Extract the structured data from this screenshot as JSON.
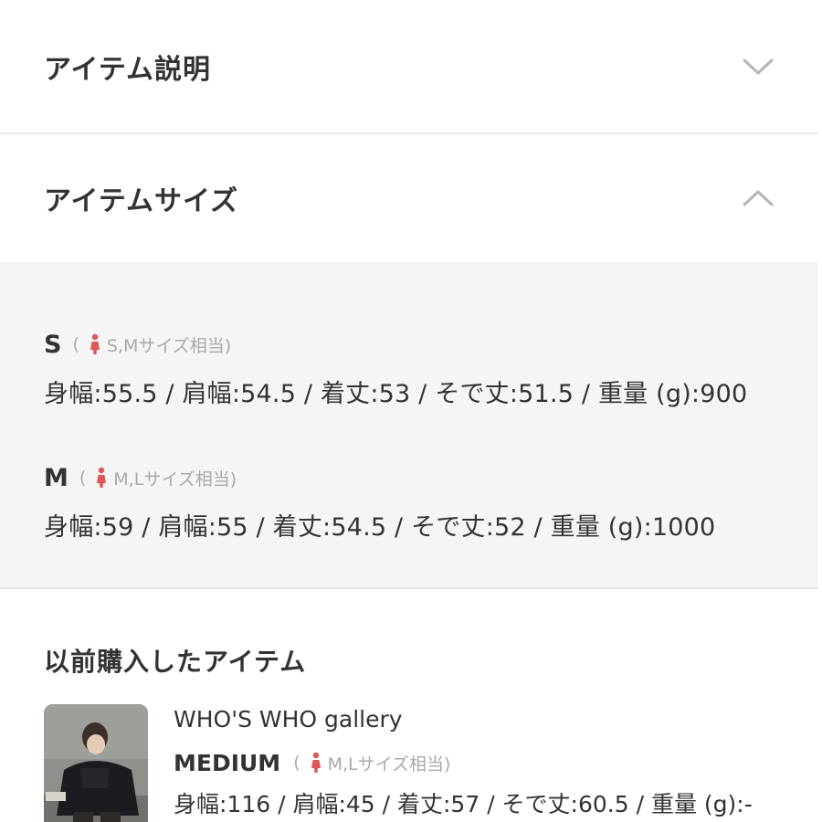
{
  "item_description": {
    "title": "アイテム説明",
    "chevron": "chevron-down-icon"
  },
  "item_size": {
    "title": "アイテムサイズ",
    "chevron": "chevron-up-icon",
    "sizes": [
      {
        "label": "S",
        "note_open": "(",
        "note_text": "S,Mサイズ相当)",
        "measurements": "身幅:55.5 / 肩幅:54.5 / 着丈:53 / そで丈:51.5 / 重量 (g):900"
      },
      {
        "label": "M",
        "note_open": "(",
        "note_text": "M,Lサイズ相当)",
        "measurements": "身幅:59 / 肩幅:55 / 着丈:54.5 / そで丈:52 / 重量 (g):1000"
      }
    ]
  },
  "previous_purchase": {
    "title": "以前購入したアイテム",
    "brand": "WHO'S WHO gallery",
    "size_label": "MEDIUM",
    "note_open": "(",
    "note_text": "M,Lサイズ相当)",
    "measurements": "身幅:116 / 肩幅:45 / 着丈:57 / そで丈:60.5 / 重量 (g):-"
  },
  "colors": {
    "text": "#333333",
    "muted": "#a9a9a9",
    "panel": "#f5f5f5",
    "person_icon": "#e0575a"
  }
}
